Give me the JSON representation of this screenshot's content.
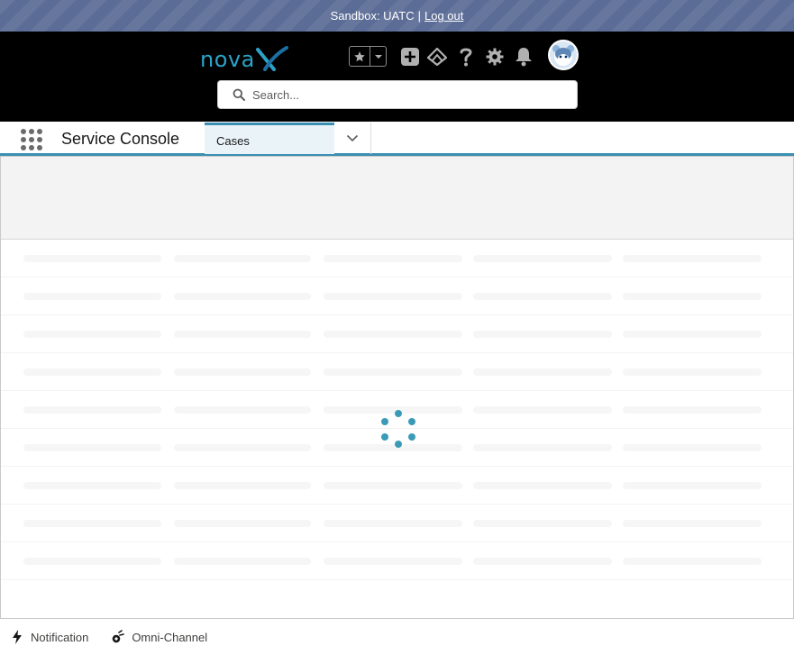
{
  "sandbox": {
    "label": "Sandbox: UATC",
    "separator": "|",
    "logout": "Log out"
  },
  "header": {
    "logo_text": "nova",
    "logo_mark": "X",
    "brand_color": "#2ba3c9",
    "icons": [
      "star-icon",
      "chevron-down-icon",
      "add-icon",
      "trailhead-icon",
      "help-icon",
      "gear-icon",
      "bell-icon",
      "avatar"
    ],
    "search": {
      "placeholder": "Search..."
    }
  },
  "nav": {
    "app_name": "Service Console",
    "tabs": [
      {
        "label": "Cases",
        "active": true
      }
    ],
    "accent": "#3a8fb3"
  },
  "workspace": {
    "state": "loading",
    "spinner_color": "#3b9bb7"
  },
  "utility_bar": {
    "items": [
      {
        "label": "Notification",
        "icon": "lightning-icon"
      },
      {
        "label": "Omni-Channel",
        "icon": "omni-channel-icon"
      }
    ]
  }
}
